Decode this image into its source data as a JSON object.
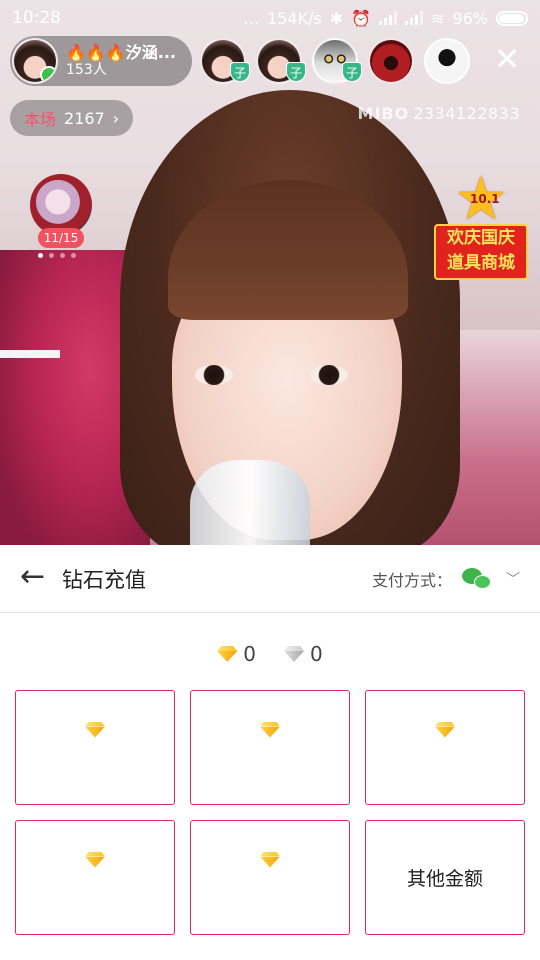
{
  "status_bar": {
    "time": "10:28",
    "dots": "...",
    "net_speed": "154K/s",
    "battery": "96%",
    "battery_level": 0.96
  },
  "host": {
    "name": "🔥🔥🔥汐涵...",
    "count": "153人"
  },
  "viewers": [
    {
      "badge": "子"
    },
    {
      "badge": "子"
    },
    {
      "badge": "子"
    },
    {
      "badge": ""
    },
    {
      "badge": ""
    }
  ],
  "score": {
    "label": "本场",
    "value": "2167",
    "chevron": "›"
  },
  "room": {
    "brand": "MIBO",
    "id": "2334122833"
  },
  "mini_rank": {
    "pages": "11/15"
  },
  "promo": {
    "num": "10.1",
    "line1": "欢庆国庆",
    "line2": "道具商城"
  },
  "close_icon": "✕",
  "panel": {
    "back_icon": "←",
    "title": "钻石充值",
    "pay_label": "支付方式：",
    "pay_chevron": "﹀"
  },
  "balance": {
    "gold": "0",
    "silver": "0"
  },
  "options": [
    {
      "type": "gem",
      "label": ""
    },
    {
      "type": "gem",
      "label": ""
    },
    {
      "type": "gem",
      "label": ""
    },
    {
      "type": "gem",
      "label": ""
    },
    {
      "type": "gem",
      "label": ""
    },
    {
      "type": "text",
      "label": "其他金额"
    }
  ],
  "colors": {
    "accent": "#e3256b",
    "score_label": "#ff4f6a",
    "wechat": "#3db34a",
    "badge_green": "#35b787"
  }
}
